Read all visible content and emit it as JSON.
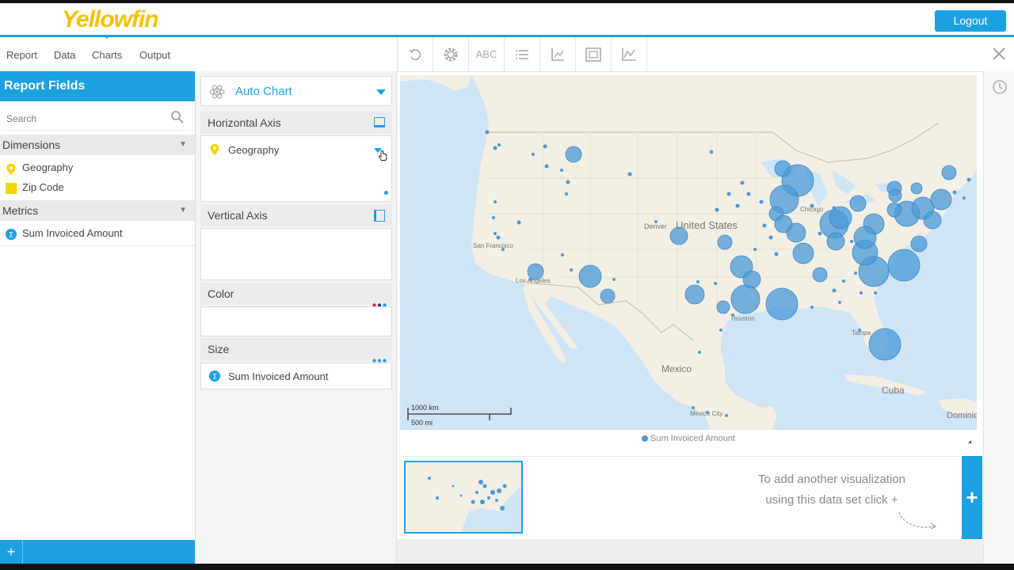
{
  "app": {
    "logo_text": "Yellowfin",
    "logout_label": "Logout"
  },
  "tabs": [
    "Report",
    "Data",
    "Charts",
    "Output"
  ],
  "toolbar": {
    "icons": [
      "undo-icon",
      "settings-icon",
      "text-format-icon",
      "list-icon",
      "axis-icon",
      "image-icon",
      "line-chart-icon"
    ],
    "abc_label": "ABC",
    "close_icon": "close-icon"
  },
  "report_fields": {
    "title": "Report Fields",
    "search_placeholder": "Search",
    "dimensions_label": "Dimensions",
    "dimensions": [
      {
        "label": "Geography",
        "icon": "map-pin-icon",
        "color": "#f5d400"
      },
      {
        "label": "Zip Code",
        "icon": "square-icon",
        "color": "#f5d400"
      }
    ],
    "metrics_label": "Metrics",
    "metrics": [
      {
        "label": "Sum Invoiced Amount",
        "icon": "sigma-icon",
        "color": "#1ba1e2"
      }
    ]
  },
  "chart_config": {
    "chart_type": "Auto Chart",
    "horizontal_axis_label": "Horizontal Axis",
    "horizontal_axis_field": "Geography",
    "vertical_axis_label": "Vertical Axis",
    "color_label": "Color",
    "size_label": "Size",
    "size_field": "Sum Invoiced Amount"
  },
  "map": {
    "labels": {
      "united_states": "United States",
      "mexico": "Mexico",
      "cuba": "Cuba",
      "denver": "Denver",
      "san_francisco": "San Francisco",
      "los_angeles": "Los Angeles",
      "chicago": "Chicago",
      "houston": "Houston",
      "dominican": "Dominic",
      "mexico_city": "Mexico City",
      "tampa": "Tampa"
    },
    "scale_km": "1000 km",
    "scale_mi": "500 mi",
    "legend": "Sum Invoiced Amount",
    "bubble_color": "#4a9ad8",
    "water_color": "#cfe4f5",
    "land_color": "#f3efe4"
  },
  "visualizations": {
    "add_text_line1": "To add another visualization",
    "add_text_line2": "using this data set click +",
    "add_label": "+"
  },
  "colors": {
    "accent": "#1ba1e2"
  }
}
